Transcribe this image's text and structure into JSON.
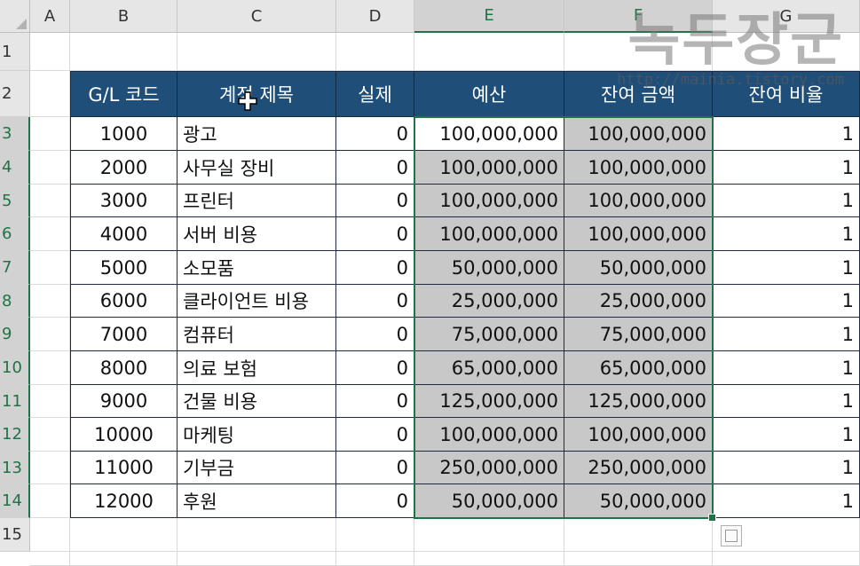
{
  "columns": [
    "A",
    "B",
    "C",
    "D",
    "E",
    "F",
    "G"
  ],
  "rows": [
    "1",
    "2",
    "3",
    "4",
    "5",
    "6",
    "7",
    "8",
    "9",
    "10",
    "11",
    "12",
    "13",
    "14",
    "15"
  ],
  "table": {
    "headers": [
      "G/L 코드",
      "계정 제목",
      "실제",
      "예산",
      "잔여 금액",
      "잔여 비율"
    ],
    "rows": [
      [
        "1000",
        "광고",
        "0",
        "100,000,000",
        "100,000,000",
        "1"
      ],
      [
        "2000",
        "사무실 장비",
        "0",
        "100,000,000",
        "100,000,000",
        "1"
      ],
      [
        "3000",
        "프린터",
        "0",
        "100,000,000",
        "100,000,000",
        "1"
      ],
      [
        "4000",
        "서버 비용",
        "0",
        "100,000,000",
        "100,000,000",
        "1"
      ],
      [
        "5000",
        "소모품",
        "0",
        "50,000,000",
        "50,000,000",
        "1"
      ],
      [
        "6000",
        "클라이언트 비용",
        "0",
        "25,000,000",
        "25,000,000",
        "1"
      ],
      [
        "7000",
        "컴퓨터",
        "0",
        "75,000,000",
        "75,000,000",
        "1"
      ],
      [
        "8000",
        "의료 보험",
        "0",
        "65,000,000",
        "65,000,000",
        "1"
      ],
      [
        "9000",
        "건물 비용",
        "0",
        "125,000,000",
        "125,000,000",
        "1"
      ],
      [
        "10000",
        "마케팅",
        "0",
        "100,000,000",
        "100,000,000",
        "1"
      ],
      [
        "11000",
        "기부금",
        "0",
        "250,000,000",
        "250,000,000",
        "1"
      ],
      [
        "12000",
        "후원",
        "0",
        "50,000,000",
        "50,000,000",
        "1"
      ]
    ]
  },
  "watermark": {
    "title": "녹두장군",
    "url": "http://mainia.tistory.com"
  },
  "colors": {
    "header_fill": "#1f4e79",
    "selection": "#217346",
    "shade": "#c8c8c8"
  }
}
